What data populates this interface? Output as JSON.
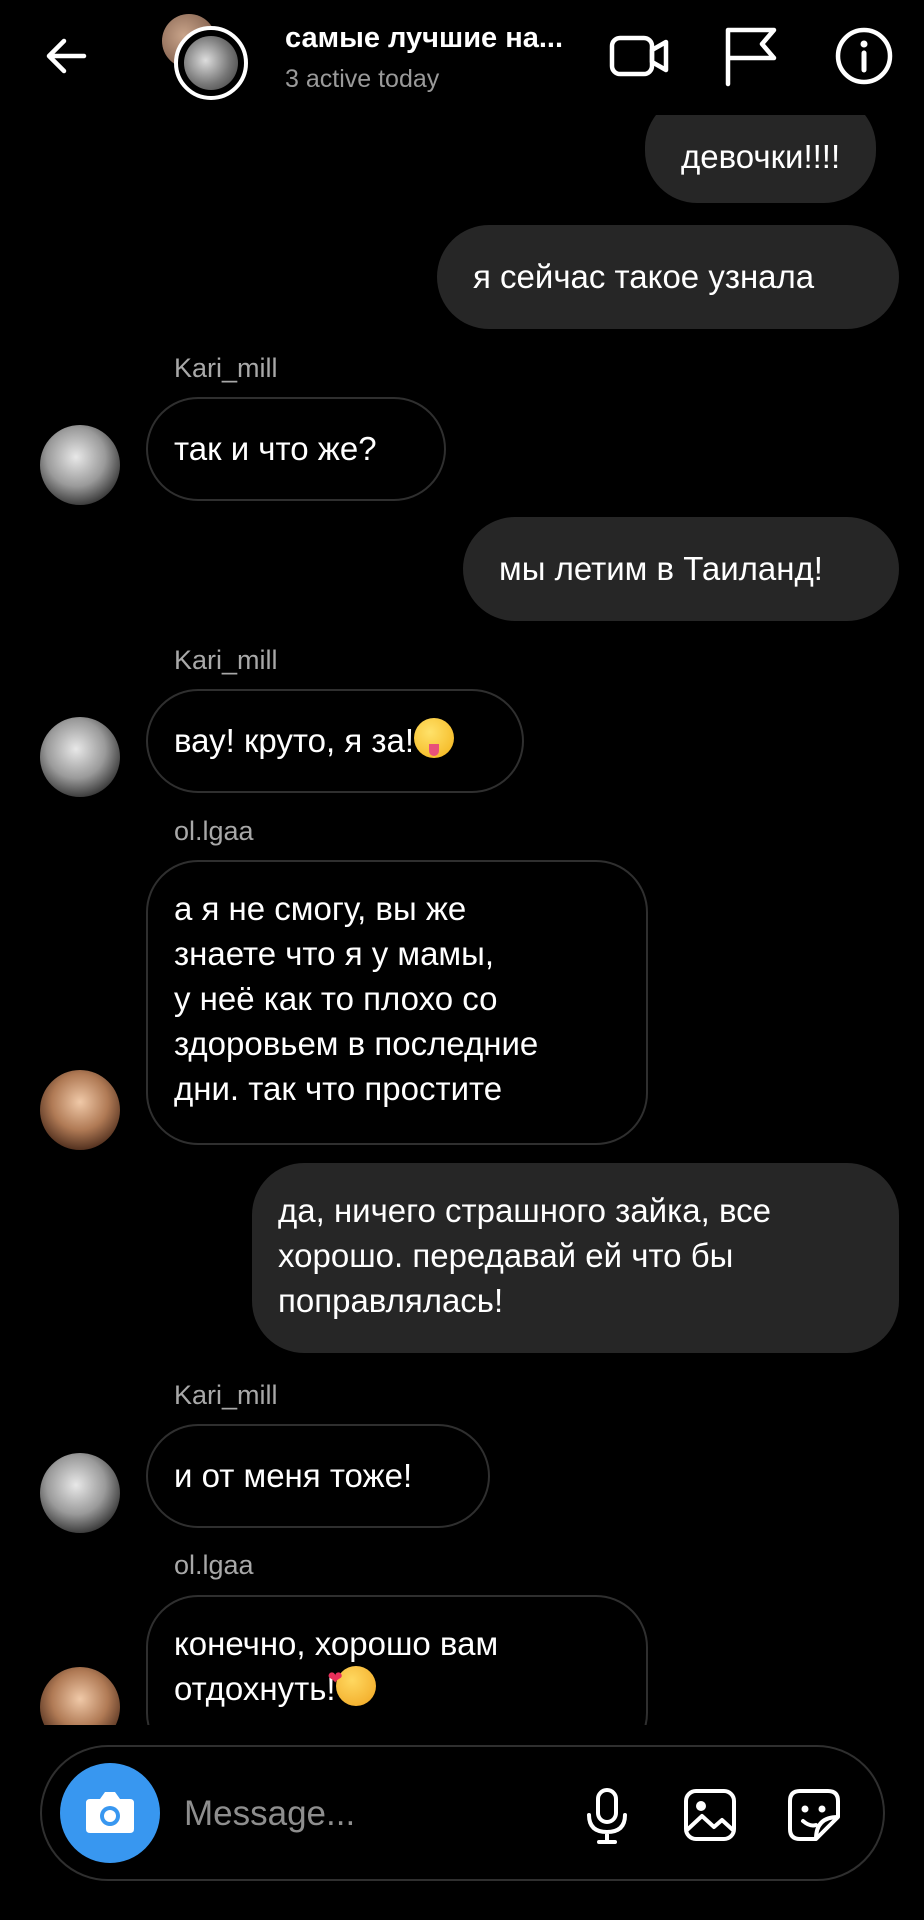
{
  "header": {
    "title": "самые лучшие на...",
    "subtitle": "3 active today",
    "icons": [
      "back-arrow-icon",
      "video-camera-icon",
      "flag-icon",
      "info-icon"
    ]
  },
  "messages": [
    {
      "direction": "out",
      "text": "девочки!!!!"
    },
    {
      "direction": "out",
      "text": "я сейчас такое узнала"
    },
    {
      "direction": "in",
      "sender": "Kari_mill",
      "text": "так и что же?"
    },
    {
      "direction": "out",
      "text": "мы летим в Таиланд!"
    },
    {
      "direction": "in",
      "sender": "Kari_mill",
      "text": "вау! круто, я за!",
      "emoji": "zany-face-emoji"
    },
    {
      "direction": "in",
      "sender": "ol.lgaa",
      "text": "а я не смогу, вы же\nзнаете что я у мамы,\nу неё как то плохо со\nздоровьем в последние\nдни. так что простите"
    },
    {
      "direction": "out",
      "text": "да, ничего страшного зайка, все\nхорошо. передавай ей что бы\nпоправлялась!"
    },
    {
      "direction": "in",
      "sender": "Kari_mill",
      "text": "и от меня тоже!"
    },
    {
      "direction": "in",
      "sender": "ol.lgaa",
      "text": "конечно, хорошо вам\nотдохнуть!",
      "emoji": "smiling-face-with-hearts-emoji"
    }
  ],
  "composer": {
    "placeholder": "Message...",
    "icons": [
      "camera-icon",
      "microphone-icon",
      "gallery-icon",
      "sticker-icon"
    ]
  },
  "colors": {
    "background": "#000000",
    "outgoing_bubble": "#262626",
    "incoming_border": "#2f2f2f",
    "camera_button": "#3897f0",
    "secondary_text": "#a8a8a8"
  }
}
